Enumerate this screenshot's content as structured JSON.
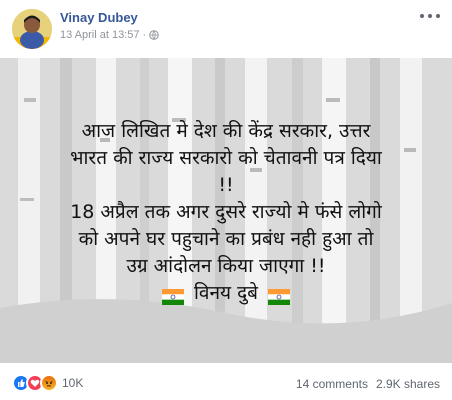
{
  "post": {
    "author": "Vinay Dubey",
    "date": "13 April at 13:57",
    "separator": "·",
    "text_lines": [
      "आज लिखित मे देश की केंद्र सरकार, उत्तर",
      "भारत की राज्य सरकारो को चेतावनी पत्र दिया",
      "!!",
      "18 अप्रैल तक अगर दुसरे राज्यो मे फंसे लोगो",
      "को अपने घर पहुचाने का प्रबंध नही हुआ तो",
      "उग्र आंदोलन किया जाएगा !!"
    ],
    "signature": "विनय दुबे"
  },
  "footer": {
    "reaction_count": "10K",
    "comments": "14 comments",
    "shares": "2.9K shares"
  },
  "icons": {
    "globe": "globe-icon",
    "more": "more-options-icon",
    "like": "like-reaction-icon",
    "love": "love-reaction-icon",
    "angry": "angry-reaction-icon",
    "flag": "india-flag-icon"
  },
  "colors": {
    "author_link": "#365899",
    "meta_text": "#90949c",
    "like_blue": "#1877f2",
    "love_red": "#f33e58",
    "angry_orange": "#e9710f",
    "saffron": "#ff9933",
    "india_green": "#138808"
  }
}
